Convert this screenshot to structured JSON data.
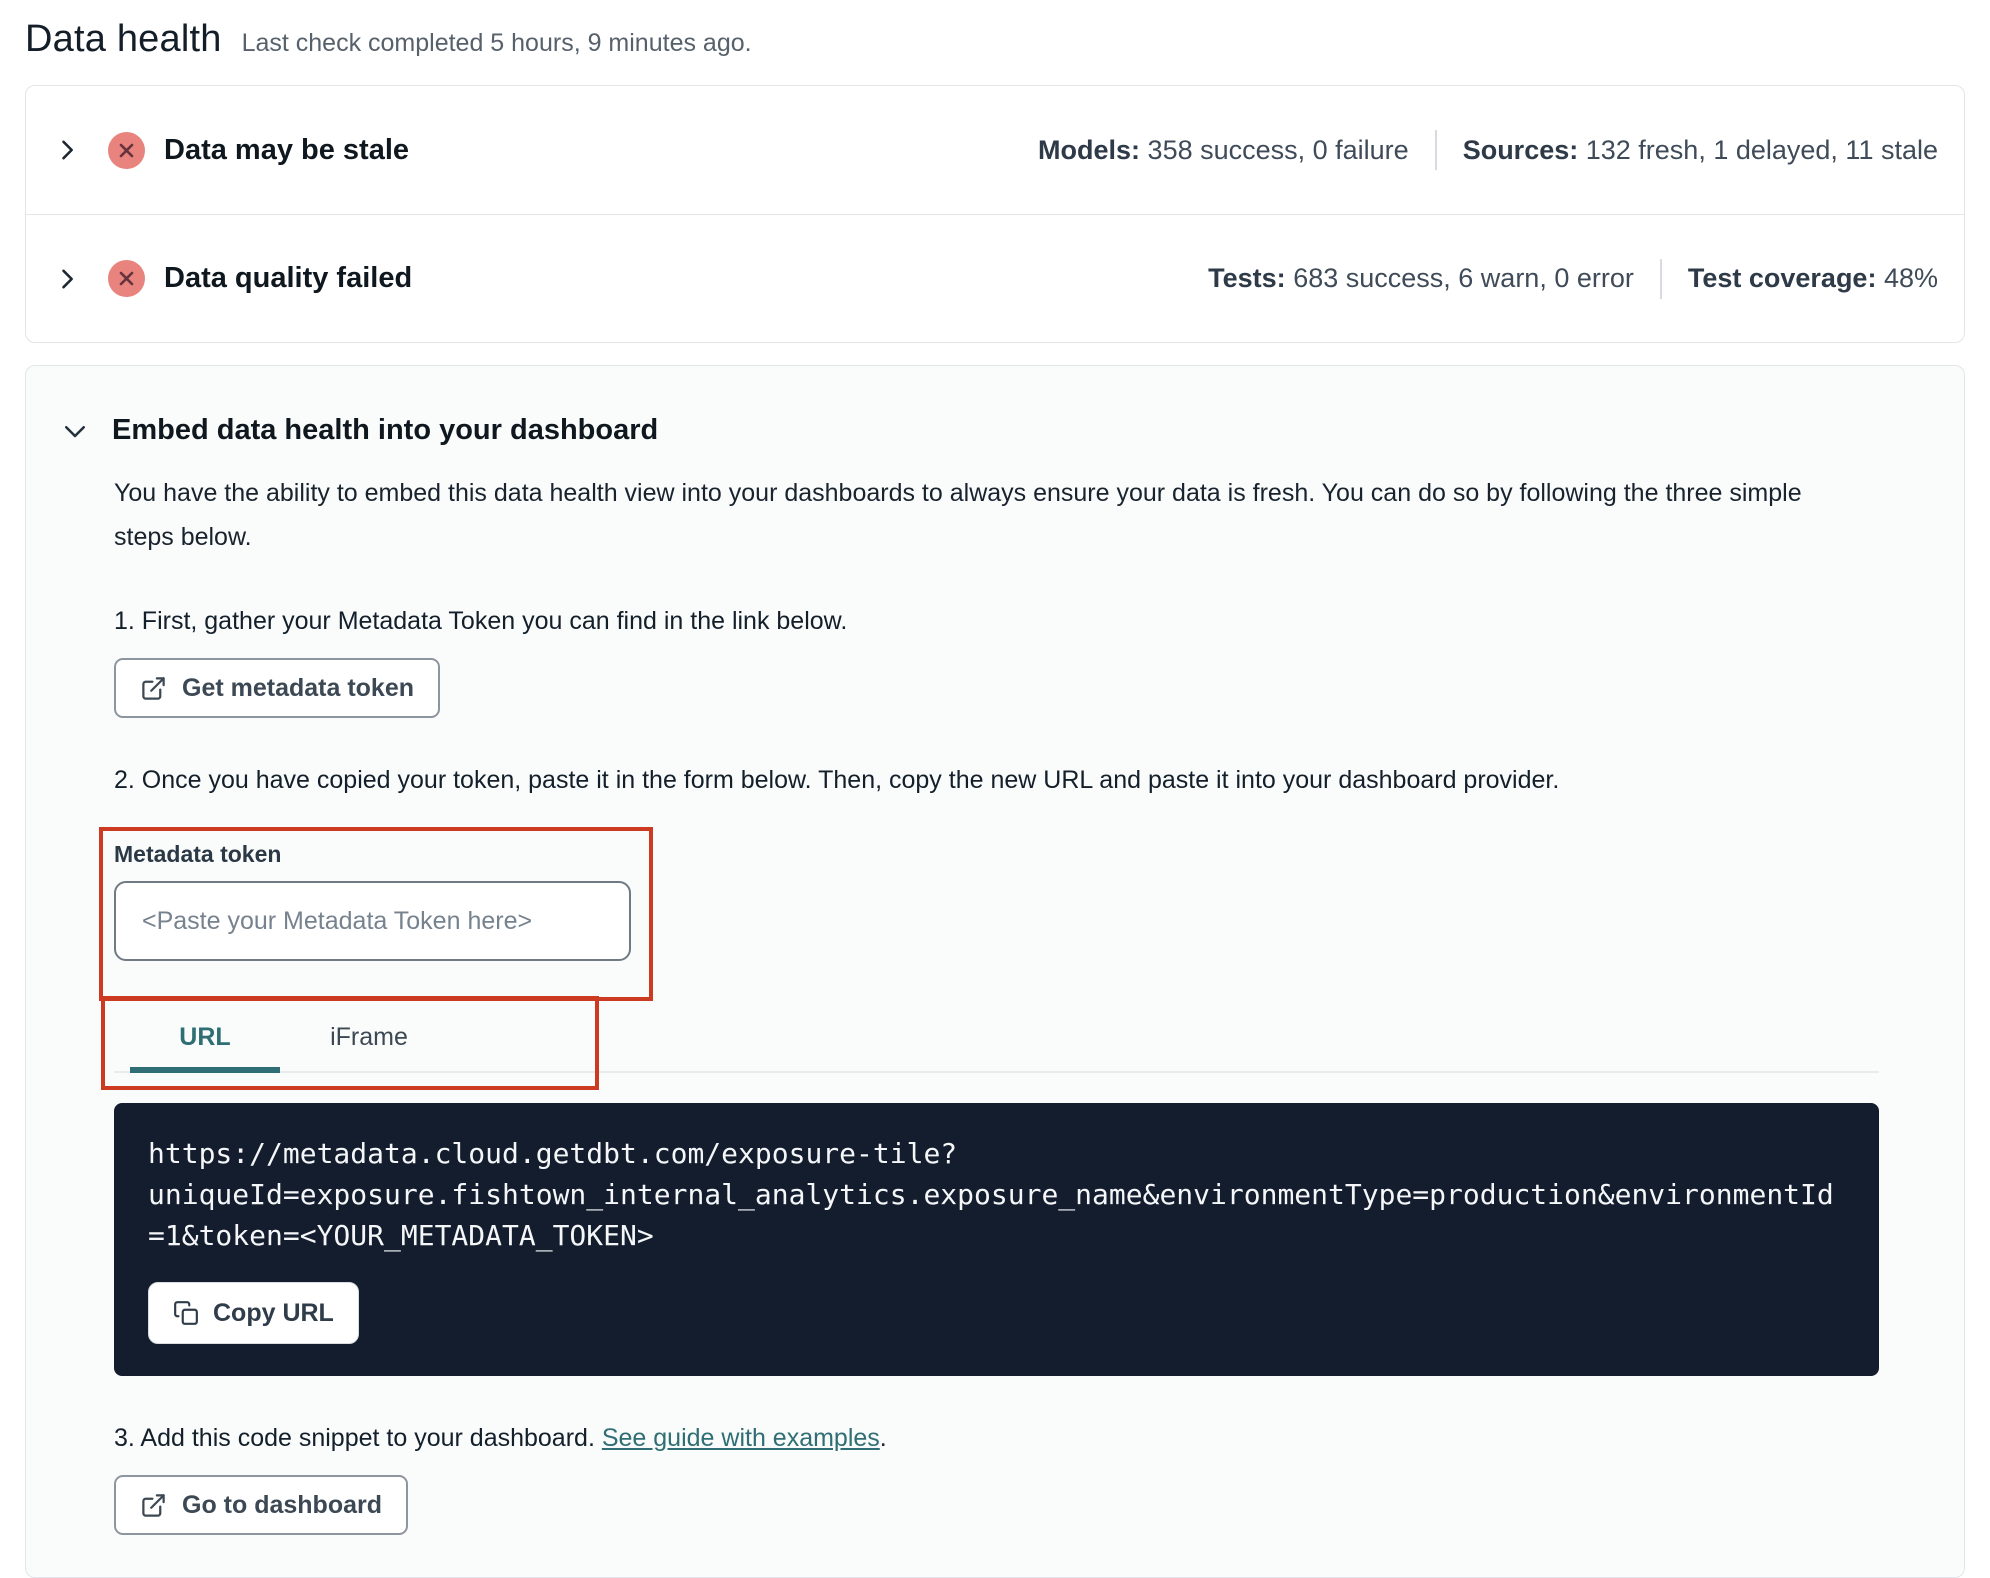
{
  "colors": {
    "accent_teal": "#2E6E74",
    "error_icon_bg": "#E8837D",
    "error_icon_x": "#66323C",
    "annotation_red": "#CC3A21",
    "code_background": "#141D2E"
  },
  "header": {
    "title": "Data health",
    "subtitle": "Last check completed 5 hours, 9 minutes ago."
  },
  "status_rows": [
    {
      "title": "Data may be stale",
      "stats": [
        {
          "label": "Models:",
          "value": "358 success, 0 failure"
        },
        {
          "label": "Sources:",
          "value": "132 fresh, 1 delayed, 11 stale"
        }
      ]
    },
    {
      "title": "Data quality failed",
      "stats": [
        {
          "label": "Tests:",
          "value": "683 success, 6 warn, 0 error"
        },
        {
          "label": "Test coverage:",
          "value": "48%"
        }
      ]
    }
  ],
  "embed": {
    "title": "Embed data health into your dashboard",
    "description": "You have the ability to embed this data health view into your dashboards to always ensure your data is fresh. You can do so by following the three simple steps below.",
    "step1": "1. First, gather your Metadata Token you can find in the link below.",
    "get_token_button": "Get metadata token",
    "step2": "2. Once you have copied your token, paste it in the form below. Then, copy the new URL and paste it into your dashboard provider.",
    "token_field": {
      "label": "Metadata token",
      "placeholder": "<Paste your Metadata Token here>"
    },
    "tabs": {
      "url": "URL",
      "iframe": "iFrame"
    },
    "embed_url": "https://metadata.cloud.getdbt.com/exposure-tile?uniqueId=exposure.fishtown_internal_analytics.exposure_name&environmentType=production&environmentId=1&token=<YOUR_METADATA_TOKEN>",
    "copy_button": "Copy URL",
    "step3": "3. Add this code snippet to your dashboard. ",
    "step3_link": "See guide with examples",
    "step3_period": ".",
    "dashboard_button": "Go to dashboard"
  }
}
